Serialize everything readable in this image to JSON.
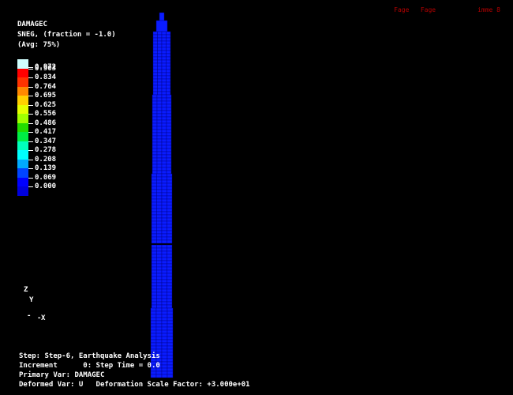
{
  "header_right": "Fage   Fage           imme 8",
  "legend": {
    "title_lines": [
      "DAMAGEC",
      "SNEG, (fraction = -1.0)",
      "(Avg: 75%)"
    ],
    "values": [
      "0.972",
      "0.903",
      "0.834",
      "0.764",
      "0.695",
      "0.625",
      "0.556",
      "0.486",
      "0.417",
      "0.347",
      "0.278",
      "0.208",
      "0.139",
      "0.069",
      "0.000"
    ],
    "colors": [
      "#d0ffff",
      "#ff0000",
      "#ff3300",
      "#ff8800",
      "#ffd000",
      "#e6ff00",
      "#a0ff00",
      "#22dd00",
      "#00ee44",
      "#00ffbb",
      "#00ffff",
      "#00aaff",
      "#0044ff",
      "#0000ff",
      "#0000dd"
    ]
  },
  "triad": {
    "z_label": "Z",
    "y_label": "Y",
    "x_label": "X"
  },
  "status": {
    "line1": "Step: Step-6, Earthquake Analysis",
    "line2": "Increment      0: Step Time = 0.0",
    "line3": "Primary Var: DAMAGEC",
    "line4": "Deformed Var: U   Deformation Scale Factor: +3.000e+01"
  },
  "model": {
    "mesh_color": "#0a1cff",
    "edge_color": "#000080"
  }
}
